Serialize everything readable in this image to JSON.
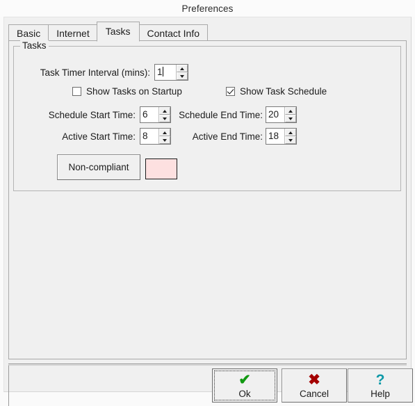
{
  "window": {
    "title": "Preferences"
  },
  "tabs": [
    {
      "label": "Basic",
      "selected": false
    },
    {
      "label": "Internet",
      "selected": false
    },
    {
      "label": "Tasks",
      "selected": true
    },
    {
      "label": "Contact Info",
      "selected": false
    }
  ],
  "tasks_group": {
    "title": "Tasks",
    "task_timer": {
      "label": "Task Timer Interval (mins):",
      "value": "1"
    },
    "show_tasks_on_startup": {
      "label": "Show Tasks on Startup",
      "checked": false
    },
    "show_task_schedule": {
      "label": "Show Task Schedule",
      "checked": true
    },
    "schedule_start": {
      "label": "Schedule Start Time:",
      "value": "6"
    },
    "schedule_end": {
      "label": "Schedule End Time:",
      "value": "20"
    },
    "active_start": {
      "label": "Active Start Time:",
      "value": "8"
    },
    "active_end": {
      "label": "Active End Time:",
      "value": "18"
    },
    "non_compliant": {
      "button_label": "Non-compliant",
      "swatch_color": "#FDE0E0"
    }
  },
  "dialog_buttons": [
    {
      "label": "Ok",
      "icon": "check-icon",
      "glyph": "✔",
      "color": "#119911",
      "focused": true
    },
    {
      "label": "Cancel",
      "icon": "x-icon",
      "glyph": "✖",
      "color": "#A40000",
      "focused": false
    },
    {
      "label": "Help",
      "icon": "question-icon",
      "glyph": "?",
      "color": "#0F9AA8",
      "focused": false
    }
  ]
}
